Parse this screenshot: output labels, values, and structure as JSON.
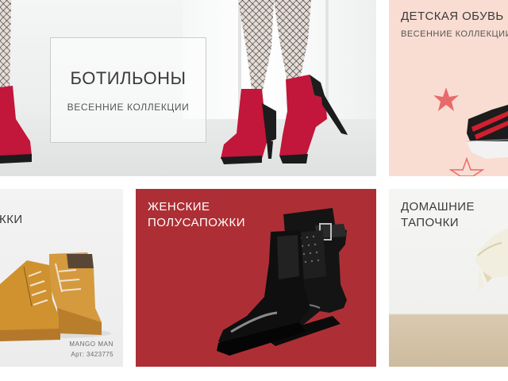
{
  "tiles": {
    "booties": {
      "title": "БОТИЛЬОНЫ",
      "subtitle": "ВЕСЕННИЕ КОЛЛЕКЦИИ"
    },
    "kids": {
      "title": "ДЕТСКАЯ ОБУВЬ",
      "subtitle": "ВЕСЕННИЕ КОЛЛЕКЦИИ"
    },
    "boots": {
      "title": "ЖКИ",
      "brand": "MANGO MAN",
      "sku": "Арт: 3423775"
    },
    "women": {
      "title": "ЖЕНСКИЕ\nПОЛУСАПОЖКИ"
    },
    "slippers": {
      "title": "ДОМАШНИЕ\nТАПОЧКИ"
    }
  },
  "colors": {
    "kids_bg": "#f9ddd2",
    "women_bg": "#ad2f35",
    "shoe_red": "#c2163a",
    "accent_star": "#e86a6a"
  }
}
